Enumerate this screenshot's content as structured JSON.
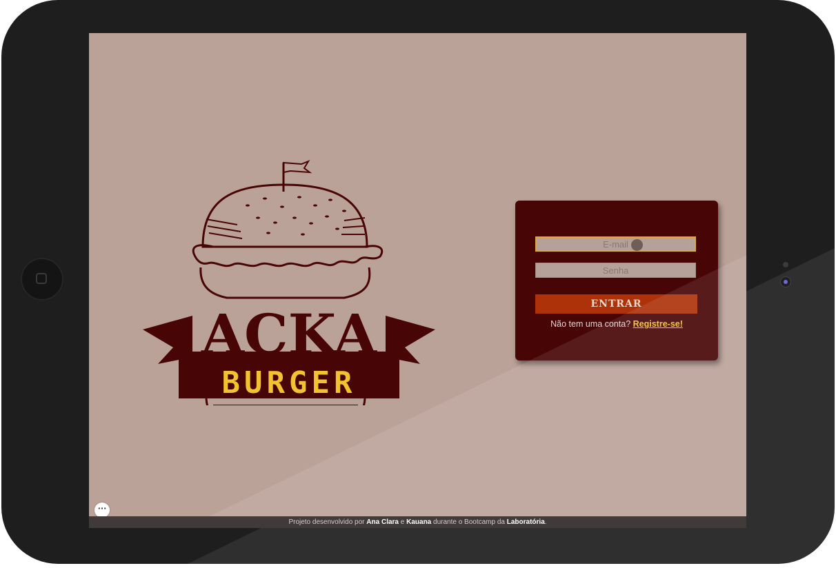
{
  "logo": {
    "name": "ACKA",
    "tagline": "BURGER",
    "colors": {
      "primary": "#470505",
      "accent": "#f2c230"
    }
  },
  "login": {
    "email_placeholder": "E-mail",
    "password_placeholder": "Senha",
    "submit_label": "ENTRAR",
    "signup_prompt": "Não tem uma conta?",
    "signup_link": "Registre-se!"
  },
  "footer": {
    "prefix": "Projeto desenvolvido por",
    "author1": "Ana Clara",
    "conj": "e",
    "author2": "Kauana",
    "middle": "durante o Bootcamp da",
    "org": "Laboratória",
    "suffix": "."
  },
  "menu_button": {
    "label": "···"
  },
  "colors": {
    "background": "#bba298",
    "card": "#470505",
    "button": "#ad3209",
    "link": "#f2c230",
    "input_focus_border": "#e0a640",
    "device_frame": "#1e1e1e"
  },
  "icons": [
    "home-button-icon",
    "camera-icon",
    "more-options-icon"
  ]
}
